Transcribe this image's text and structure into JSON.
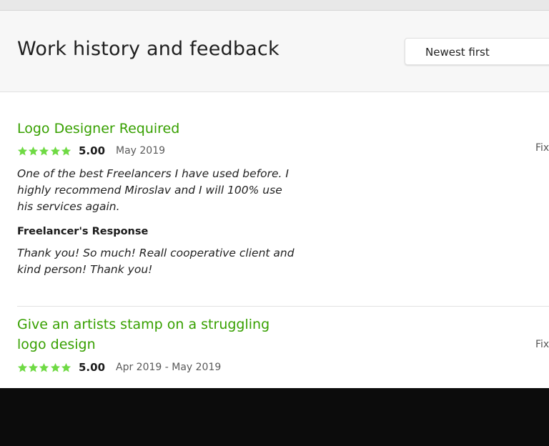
{
  "header": {
    "title": "Work history and feedback",
    "sort_select": {
      "selected": "Newest first"
    }
  },
  "jobs": [
    {
      "title": "Logo Designer Required",
      "rating": 5,
      "score": "5.00",
      "dates": "May 2019",
      "feedback": "One of the best Freelancers I have used before. I highly recommend Miroslav and I will 100% use his services again.",
      "response_label": "Freelancer's Response",
      "response": "Thank you! So much! Reall cooperative client and kind person! Thank you!",
      "type_truncated": "Fix"
    },
    {
      "title": "Give an artists stamp on a struggling logo design",
      "rating": 5,
      "score": "5.00",
      "dates": "Apr 2019 - May 2019",
      "type_truncated": "Fix"
    }
  ],
  "colors": {
    "accent_green": "#37a000",
    "star_green": "#6fda44",
    "header_bg": "#f7f7f7",
    "overlay_black": "#0c0c0c"
  },
  "icons": {
    "rating": "star-icon"
  }
}
